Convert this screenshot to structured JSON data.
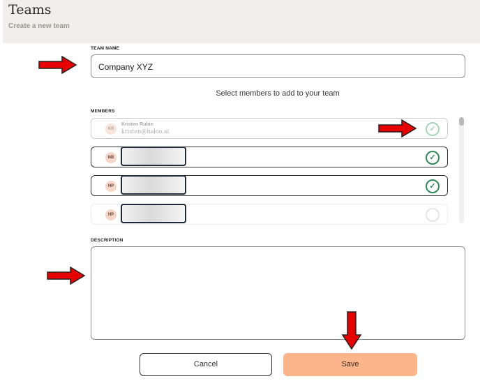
{
  "header": {
    "title": "Teams",
    "subtitle": "Create a new team"
  },
  "team_name": {
    "label": "TEAM NAME",
    "value": "Company XYZ"
  },
  "select_prompt": "Select members to add to your team",
  "members": {
    "label": "MEMBERS",
    "items": [
      {
        "initials": "KR",
        "name": "Kristen Rubin",
        "email": "kristen@haloo.ai",
        "selected": true,
        "redacted": false
      },
      {
        "initials": "NB",
        "selected": true,
        "redacted": true
      },
      {
        "initials": "HP",
        "selected": true,
        "redacted": true
      },
      {
        "initials": "HP",
        "selected": false,
        "redacted": true
      }
    ]
  },
  "description": {
    "label": "DESCRIPTION",
    "value": ""
  },
  "actions": {
    "cancel_label": "Cancel",
    "save_label": "Save"
  },
  "colors": {
    "header_bg": "#f1efec",
    "save_bg": "#fcb48a",
    "check": "#2e8b57",
    "annotation_arrow": "#e60000",
    "avatar_bg": "#f6d6c8"
  },
  "annotations": [
    "arrow-right",
    "arrow-right",
    "arrow-right",
    "arrow-down"
  ]
}
